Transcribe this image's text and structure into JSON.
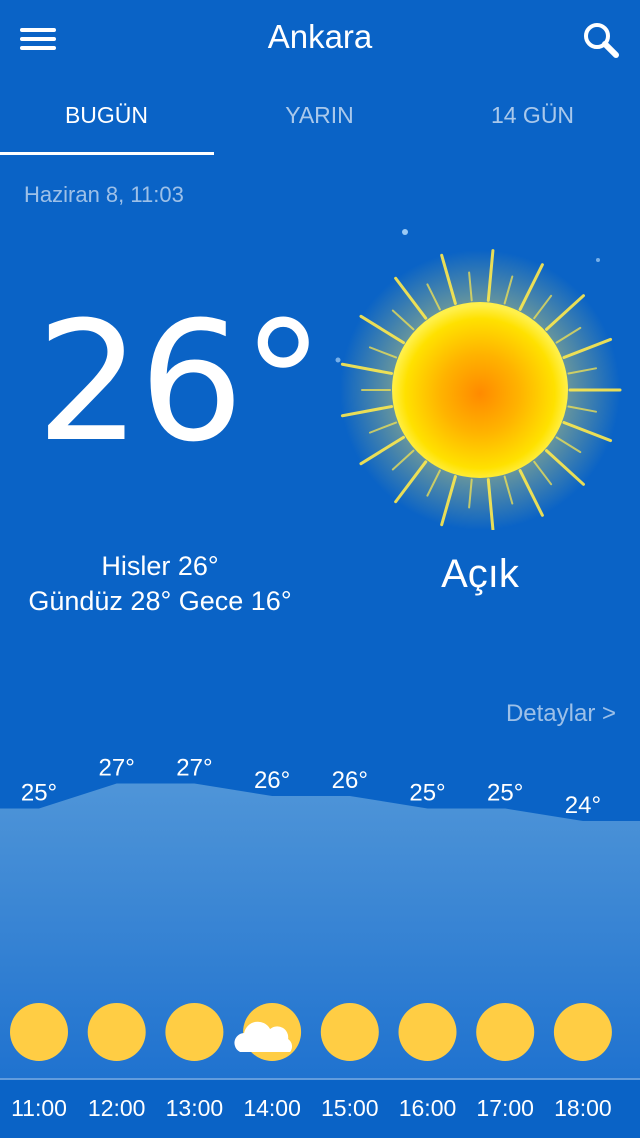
{
  "header": {
    "menu_icon": "hamburger-menu-icon",
    "city": "Ankara",
    "search_icon": "search-icon"
  },
  "tabs": [
    {
      "label": "BUGÜN",
      "active": true
    },
    {
      "label": "YARIN",
      "active": false
    },
    {
      "label": "14 GÜN",
      "active": false
    }
  ],
  "current": {
    "datetime": "Haziran 8, 11:03",
    "temperature": "26°",
    "feels_like": "Hisler 26°",
    "day_night": "Gündüz 28° Gece 16°",
    "condition": "Açık",
    "condition_icon": "sun-icon"
  },
  "details_link": "Detaylar >",
  "hourly": [
    {
      "time": "11:00",
      "temp": "25°",
      "value": 25,
      "icon": "sun-icon"
    },
    {
      "time": "12:00",
      "temp": "27°",
      "value": 27,
      "icon": "sun-icon"
    },
    {
      "time": "13:00",
      "temp": "27°",
      "value": 27,
      "icon": "sun-icon"
    },
    {
      "time": "14:00",
      "temp": "26°",
      "value": 26,
      "icon": "partly-cloudy-icon"
    },
    {
      "time": "15:00",
      "temp": "26°",
      "value": 26,
      "icon": "sun-icon"
    },
    {
      "time": "16:00",
      "temp": "25°",
      "value": 25,
      "icon": "sun-icon"
    },
    {
      "time": "17:00",
      "temp": "25°",
      "value": 25,
      "icon": "sun-icon"
    },
    {
      "time": "18:00",
      "temp": "24°",
      "value": 24,
      "icon": "sun-icon"
    }
  ],
  "colors": {
    "background": "#0a63c6",
    "sun_icon": "#ffcd44",
    "graph_top": "#4f95d8",
    "graph_bottom": "#1f72cf"
  }
}
